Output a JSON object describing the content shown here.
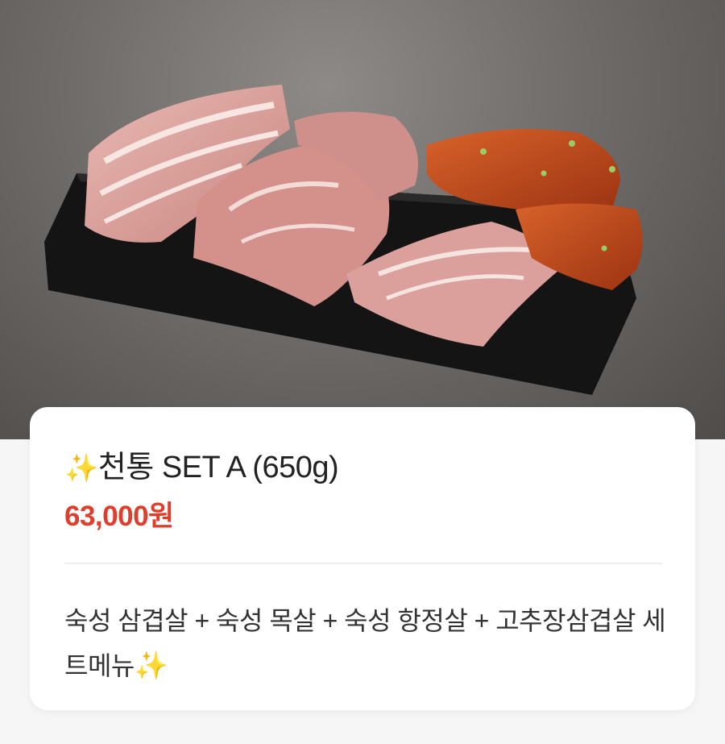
{
  "product": {
    "title_sparkle": "✨",
    "title": "천통 SET A (650g)",
    "price": "63,000원",
    "description": "숙성 삼겹살 + 숙성 목살 + 숙성 항정살 + 고추장삼겹살 세트메뉴",
    "description_sparkle": "✨"
  },
  "photo": {
    "subject": "pork cuts on black slate board"
  },
  "colors": {
    "price": "#e03e2d",
    "title": "#222222",
    "background": "#ffffff"
  }
}
